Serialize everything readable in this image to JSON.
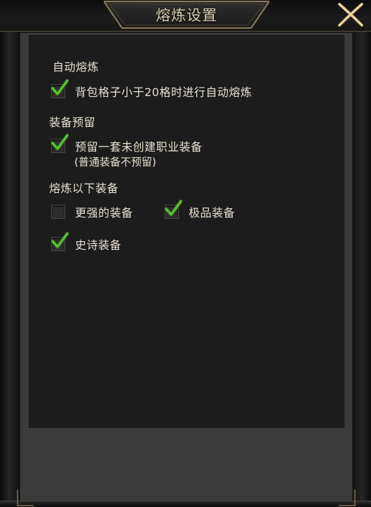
{
  "window": {
    "title": "熔炼设置"
  },
  "sections": [
    {
      "label": "自动熔炼",
      "options": [
        {
          "label": "背包格子小于20格时进行自动熔炼",
          "checked": true
        }
      ]
    },
    {
      "label": "装备预留",
      "options": [
        {
          "label": "预留一套未创建职业装备",
          "checked": true
        }
      ],
      "note": "(普通装备不预留)"
    },
    {
      "label": "熔炼以下装备",
      "options": [
        {
          "label": "更强的装备",
          "checked": false
        },
        {
          "label": "极品装备",
          "checked": true
        },
        {
          "label": "史诗装备",
          "checked": true
        }
      ]
    }
  ],
  "colors": {
    "check": "#5cc236",
    "text": "#e7e0d2",
    "title": "#d9cdb0",
    "frame_gold": "#8a7a57"
  },
  "icons": {
    "close": "close-x-icon",
    "check": "checkmark-icon"
  }
}
